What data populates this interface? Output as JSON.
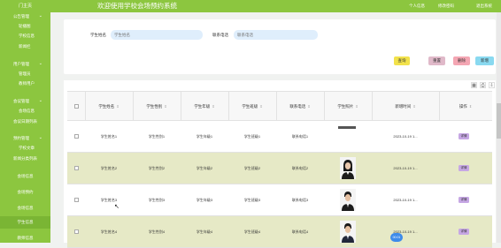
{
  "header": {
    "home_label": "门主页",
    "title": "欢迎使用学校会场预约系统",
    "personal_center": "个人信息",
    "change_password": "修改密码",
    "exit": "退出系统"
  },
  "sidebar": {
    "items": [
      {
        "label": "公告管理",
        "kind": "group",
        "expanded": true
      },
      {
        "label": "轮播图",
        "kind": "sub"
      },
      {
        "label": "学校信息",
        "kind": "sub"
      },
      {
        "label": "新闻栏",
        "kind": "sub"
      },
      {
        "label": "用户管理",
        "kind": "group",
        "expanded": true
      },
      {
        "label": "管理员",
        "kind": "sub"
      },
      {
        "label": "教师用户",
        "kind": "sub"
      },
      {
        "label": "会议管理",
        "kind": "group",
        "expanded": true
      },
      {
        "label": "会场信息",
        "kind": "sub"
      },
      {
        "label": "会议日期列表",
        "kind": "plain"
      },
      {
        "label": "预约管理",
        "kind": "group",
        "expanded": true
      },
      {
        "label": "学校文章",
        "kind": "sub"
      },
      {
        "label": "新闻分类列表",
        "kind": "plain"
      },
      {
        "label": "会场信息",
        "kind": "plain"
      },
      {
        "label": "会场预约",
        "kind": "plain"
      },
      {
        "label": "会场信息",
        "kind": "plain"
      },
      {
        "label": "学生信息",
        "kind": "plain",
        "active": true
      },
      {
        "label": "教师信息",
        "kind": "plain"
      }
    ]
  },
  "search": {
    "name_label": "学生姓名",
    "name_placeholder": "学生姓名",
    "phone_label": "联系电话",
    "phone_placeholder": "联系电话",
    "buttons": [
      {
        "label": "查询",
        "color": "#f2e24b"
      },
      {
        "label": "重置",
        "color": "#e0b9c9"
      },
      {
        "label": "删除",
        "color": "#f4a6b3"
      },
      {
        "label": "新增",
        "color": "#89d9f0"
      }
    ]
  },
  "table": {
    "columns": [
      "学生姓名",
      "学生性别",
      "学生年级",
      "学生班级",
      "联系电话",
      "学生照片",
      "新增时间",
      "操作"
    ],
    "rows": [
      {
        "name": "学生姓名1",
        "gender": "学生性别1",
        "grade": "学生年级1",
        "class": "学生班级1",
        "phone": "联系电话1",
        "photo": "placeholder",
        "time": "2023-10-19 1...",
        "action": "详情"
      },
      {
        "name": "学生姓名2",
        "gender": "学生性别2",
        "grade": "学生年级2",
        "class": "学生班级2",
        "phone": "联系电话2",
        "photo": "female",
        "time": "2023-10-19 1...",
        "action": "详情"
      },
      {
        "name": "学生姓名3",
        "gender": "学生性别3",
        "grade": "学生年级3",
        "class": "学生班级3",
        "phone": "联系电话3",
        "photo": "male",
        "time": "2023-10-19 1...",
        "action": "详情"
      },
      {
        "name": "学生姓名4",
        "gender": "学生性别4",
        "grade": "学生年级4",
        "class": "学生班级4",
        "phone": "联系电话4",
        "photo": "male",
        "time": "2023-10-19 1...",
        "action": "详情"
      }
    ]
  },
  "toolbar_icons": [
    "grid-icon",
    "print-icon",
    "export-icon"
  ],
  "pagination": {
    "current_label": "00:01"
  },
  "colors": {
    "accent": "#8cc63f",
    "row_highlight": "#e6e9c6",
    "detail_tag": "#c6a7e4",
    "page_badge": "#3d8bea"
  }
}
